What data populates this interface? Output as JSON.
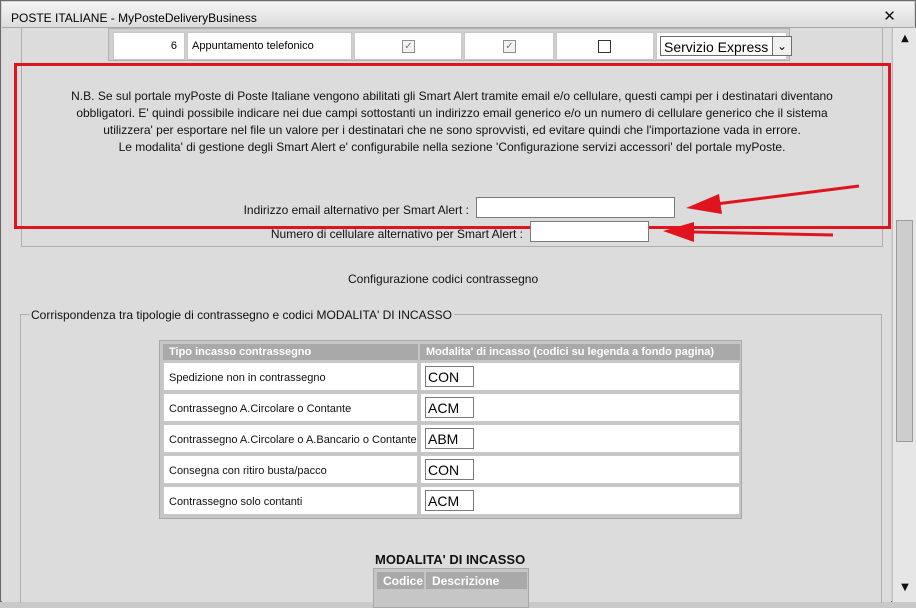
{
  "window": {
    "title": "POSTE ITALIANE - MyPosteDeliveryBusiness",
    "close_glyph": "✕"
  },
  "top_table": {
    "row_number": "6",
    "row_description": "Appuntamento telefonico",
    "col1_checked": true,
    "col2_checked": true,
    "col3_checked": false,
    "service_select_value": "Servizio Express",
    "check_glyph": "✓",
    "arrow_glyph": "⌄"
  },
  "smart_alert": {
    "note_lines": [
      "N.B. Se sul portale myPoste di Poste Italiane vengono abilitati gli Smart Alert tramite email e/o cellulare, questi campi per i destinatari diventano",
      "obbligatori. E' quindi possibile indicare nei due campi sottostanti un indirizzo email generico e/o un numero di cellulare generico che il sistema",
      "utilizzera' per esportare nel file un valore per i destinatari che ne sono sprovvisti, ed evitare quindi che l'importazione vada in errore.",
      "Le modalita' di gestione degli Smart Alert e' configurabile nella sezione 'Configurazione servizi accessori' del portale myPoste."
    ],
    "email_label": "Indirizzo email alternativo per Smart Alert :",
    "email_value": "",
    "phone_label": "Numero di cellulare alternativo per Smart Alert :",
    "phone_value": "",
    "highlight_color": "#e0141f"
  },
  "contrassegno": {
    "section_title": "Configurazione codici contrassegno",
    "fieldset_legend": "Corrispondenza tra tipologie di contrassegno e codici MODALITA' DI INCASSO",
    "columns": [
      "Tipo incasso contrassegno",
      "Modalita' di incasso (codici su legenda a fondo pagina)"
    ],
    "rows": [
      {
        "tipo": "Spedizione non in contrassegno",
        "codice": "CON"
      },
      {
        "tipo": "Contrassegno A.Circolare o Contante",
        "codice": "ACM"
      },
      {
        "tipo": "Contrassegno A.Circolare o A.Bancario o Contante",
        "codice": "ABM"
      },
      {
        "tipo": "Consegna con ritiro busta/pacco",
        "codice": "CON"
      },
      {
        "tipo": "Contrassegno solo contanti",
        "codice": "ACM"
      }
    ]
  },
  "modalita": {
    "title": "MODALITA' DI INCASSO",
    "columns": [
      "Codice",
      "Descrizione"
    ]
  },
  "scrollbar": {
    "up_glyph": "▲",
    "down_glyph": "▼",
    "position_fraction": 0.35
  }
}
